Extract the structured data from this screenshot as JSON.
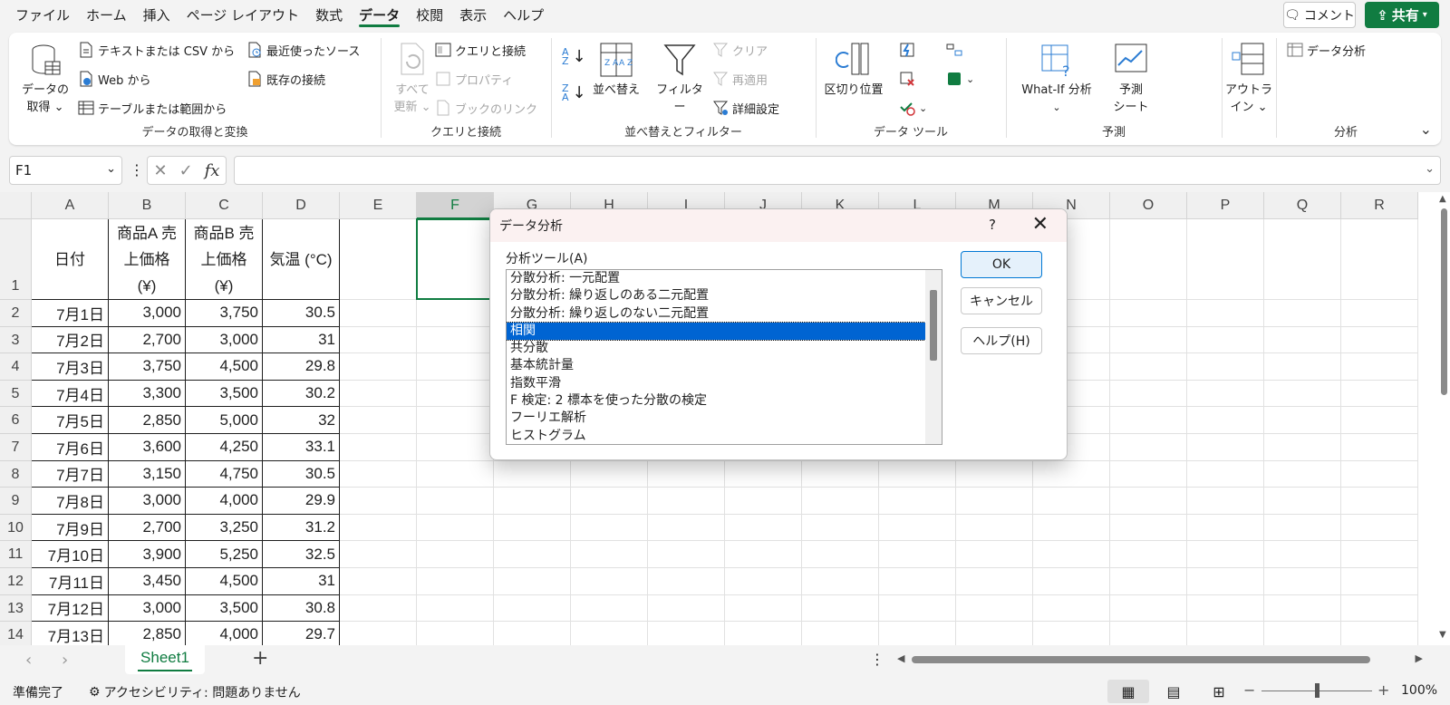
{
  "menubar": {
    "items": [
      "ファイル",
      "ホーム",
      "挿入",
      "ページ レイアウト",
      "数式",
      "データ",
      "校閲",
      "表示",
      "ヘルプ"
    ],
    "active_index": 5,
    "comment_label": "コメント",
    "share_label": "共有"
  },
  "ribbon": {
    "get_data": {
      "label": "データの取得と変換",
      "get_data_btn": [
        "データの",
        "取得"
      ],
      "text_csv": "テキストまたは CSV から",
      "web": "Web から",
      "table_range": "テーブルまたは範囲から",
      "recent_sources": "最近使ったソース",
      "existing_connections": "既存の接続"
    },
    "queries": {
      "label": "クエリと接続",
      "refresh_all": [
        "すべて",
        "更新"
      ],
      "queries_connections": "クエリと接続",
      "properties": "プロパティ",
      "edit_links": "ブックのリンク"
    },
    "sort_filter": {
      "label": "並べ替えとフィルター",
      "sort": "並べ替え",
      "filter": "フィルター",
      "clear": "クリア",
      "reapply": "再適用",
      "advanced": "詳細設定"
    },
    "data_tools": {
      "label": "データ ツール",
      "text_to_columns": "区切り位置"
    },
    "forecast": {
      "label": "予測",
      "what_if": "What-If 分析",
      "forecast_sheet": [
        "予測",
        "シート"
      ]
    },
    "outline": {
      "label": [
        "アウトラ",
        "イン"
      ]
    },
    "analysis": {
      "label": "分析",
      "data_analysis": "データ分析"
    }
  },
  "formula_bar": {
    "name_box": "F1",
    "formula": ""
  },
  "sheet": {
    "columns": [
      "A",
      "B",
      "C",
      "D",
      "E",
      "F",
      "G",
      "H",
      "I",
      "J",
      "K",
      "L",
      "M",
      "N",
      "O",
      "P",
      "Q",
      "R"
    ],
    "selected_column": "F",
    "header_row": {
      "date": "日付",
      "product_a": [
        "商品A 売",
        "上価格",
        "(¥)"
      ],
      "product_b": [
        "商品B 売",
        "上価格",
        "(¥)"
      ],
      "temp": "気温 (°C)"
    },
    "rows": [
      {
        "n": "2",
        "date": "7月1日",
        "a": "3,000",
        "b": "3,750",
        "t": "30.5"
      },
      {
        "n": "3",
        "date": "7月2日",
        "a": "2,700",
        "b": "3,000",
        "t": "31"
      },
      {
        "n": "4",
        "date": "7月3日",
        "a": "3,750",
        "b": "4,500",
        "t": "29.8"
      },
      {
        "n": "5",
        "date": "7月4日",
        "a": "3,300",
        "b": "3,500",
        "t": "30.2"
      },
      {
        "n": "6",
        "date": "7月5日",
        "a": "2,850",
        "b": "5,000",
        "t": "32"
      },
      {
        "n": "7",
        "date": "7月6日",
        "a": "3,600",
        "b": "4,250",
        "t": "33.1"
      },
      {
        "n": "8",
        "date": "7月7日",
        "a": "3,150",
        "b": "4,750",
        "t": "30.5"
      },
      {
        "n": "9",
        "date": "7月8日",
        "a": "3,000",
        "b": "4,000",
        "t": "29.9"
      },
      {
        "n": "10",
        "date": "7月9日",
        "a": "2,700",
        "b": "3,250",
        "t": "31.2"
      },
      {
        "n": "11",
        "date": "7月10日",
        "a": "3,900",
        "b": "5,250",
        "t": "32.5"
      },
      {
        "n": "12",
        "date": "7月11日",
        "a": "3,450",
        "b": "4,500",
        "t": "31"
      },
      {
        "n": "13",
        "date": "7月12日",
        "a": "3,000",
        "b": "3,500",
        "t": "30.8"
      },
      {
        "n": "14",
        "date": "7月13日",
        "a": "2,850",
        "b": "4,000",
        "t": "29.7"
      }
    ],
    "tab_name": "Sheet1"
  },
  "dialog": {
    "title": "データ分析",
    "help_glyph": "?",
    "list_label": "分析ツール(A)",
    "tools": [
      "分散分析: 一元配置",
      "分散分析: 繰り返しのある二元配置",
      "分散分析: 繰り返しのない二元配置",
      "相関",
      "共分散",
      "基本統計量",
      "指数平滑",
      "F 検定: 2 標本を使った分散の検定",
      "フーリエ解析",
      "ヒストグラム"
    ],
    "selected_index": 3,
    "ok_label": "OK",
    "cancel_label": "キャンセル",
    "help_label": "ヘルプ(H)"
  },
  "statusbar": {
    "ready": "準備完了",
    "accessibility": "アクセシビリティ: 問題ありません",
    "zoom": "100%"
  },
  "colors": {
    "accent": "#107c41",
    "selection": "#0064d2"
  }
}
